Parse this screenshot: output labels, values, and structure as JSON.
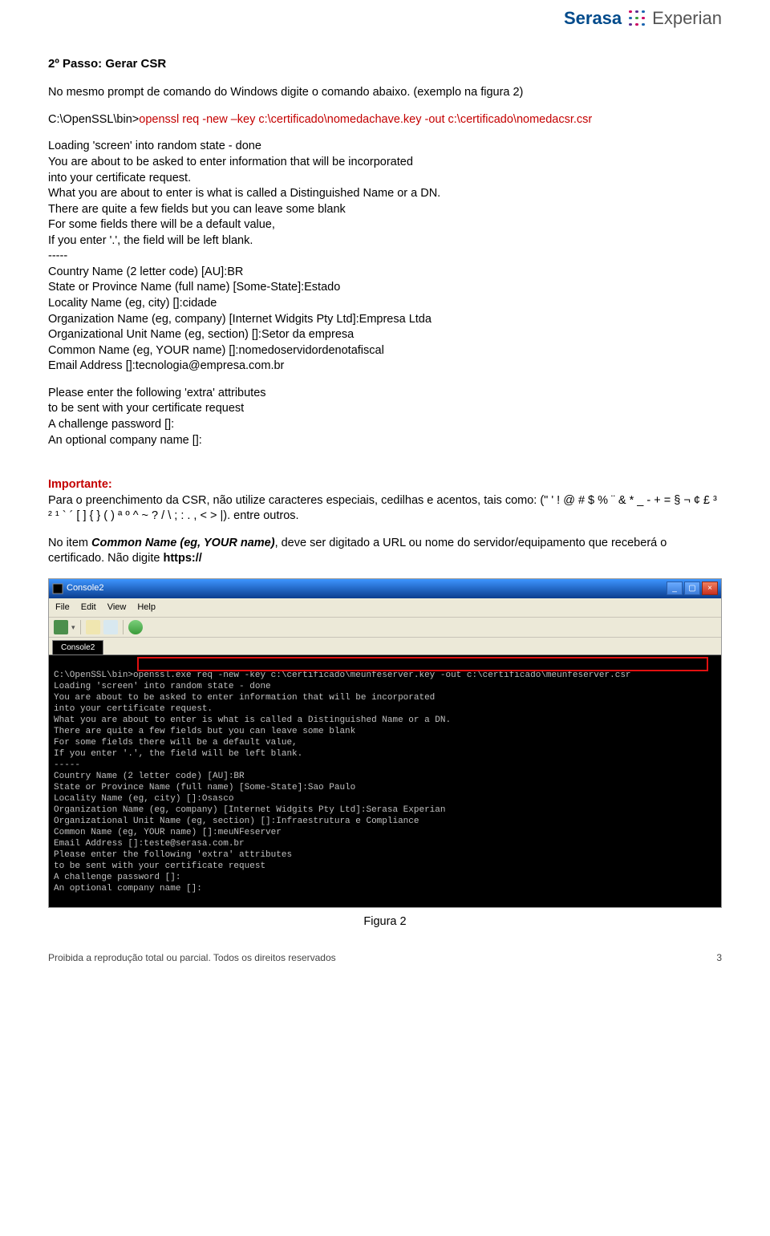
{
  "logo": {
    "serasa": "Serasa",
    "experian": "Experian"
  },
  "step_title": "2º Passo: Gerar CSR",
  "intro": "No mesmo prompt de comando do Windows digite o comando abaixo. (exemplo na figura 2)",
  "cmd_prefix": "C:\\OpenSSL\\bin>",
  "cmd_red": "openssl req -new –key c:\\certificado\\nomedachave.key -out c:\\certificado\\nomedacsr.csr",
  "output_lines": [
    "Loading 'screen' into random state - done",
    "You are about to be asked to enter information that will be incorporated",
    "into your certificate request.",
    "What you are about to enter is what is called a Distinguished Name or a DN.",
    "There are quite a few fields but you can leave some blank",
    "For some fields there will be a default value,",
    "If you enter '.', the field will be left blank.",
    "-----",
    "Country Name (2 letter code) [AU]:BR",
    "State or Province Name (full name) [Some-State]:Estado",
    "Locality Name (eg, city) []:cidade",
    "Organization Name (eg, company) [Internet Widgits Pty Ltd]:Empresa Ltda",
    "Organizational Unit Name (eg, section) []:Setor da empresa",
    "Common Name (eg, YOUR name) []:nomedoservidordenotafiscal",
    "Email Address []:tecnologia@empresa.com.br"
  ],
  "extra_title": "Please enter the following 'extra' attributes",
  "extra_lines": [
    "to be sent with your certificate request",
    "A challenge password []:",
    "An optional company name []:"
  ],
  "important_label": "Importante:",
  "important_p1_a": "Para o preenchimento da CSR, não utilize caracteres especiais, cedilhas e acentos, tais como: (\" ' ! @ # $ % ¨ & * _ - + = § ¬ ¢ £ ³ ² ¹ ` ´ [ ] { } ( ) ª º ^ ~ ? / \\ ; : . , < > |). entre outros.",
  "important_p2_pre": "No item ",
  "important_p2_bold": "Common Name (eg, YOUR name)",
  "important_p2_mid": ", deve ser digitado a URL ou nome do servidor/equipamento que receberá o certificado. Não digite ",
  "important_p2_end": "https://",
  "console": {
    "title": "Console2",
    "menu": {
      "file": "File",
      "edit": "Edit",
      "view": "View",
      "help": "Help"
    }
  },
  "terminal_lines": [
    "",
    "C:\\OpenSSL\\bin>openssl.exe req -new -key c:\\certificado\\meunfeserver.key -out c:\\certificado\\meunfeserver.csr",
    "Loading 'screen' into random state - done",
    "You are about to be asked to enter information that will be incorporated",
    "into your certificate request.",
    "What you are about to enter is what is called a Distinguished Name or a DN.",
    "There are quite a few fields but you can leave some blank",
    "For some fields there will be a default value,",
    "If you enter '.', the field will be left blank.",
    "-----",
    "Country Name (2 letter code) [AU]:BR",
    "State or Province Name (full name) [Some-State]:Sao Paulo",
    "Locality Name (eg, city) []:Osasco",
    "Organization Name (eg, company) [Internet Widgits Pty Ltd]:Serasa Experian",
    "Organizational Unit Name (eg, section) []:Infraestrutura e Compliance",
    "Common Name (eg, YOUR name) []:meuNFeserver",
    "Email Address []:teste@serasa.com.br",
    "",
    "Please enter the following 'extra' attributes",
    "to be sent with your certificate request",
    "A challenge password []:",
    "An optional company name []:"
  ],
  "figure_caption": "Figura 2",
  "footer_left": "Proibida a reprodução total ou parcial. Todos os direitos reservados",
  "footer_page": "3"
}
